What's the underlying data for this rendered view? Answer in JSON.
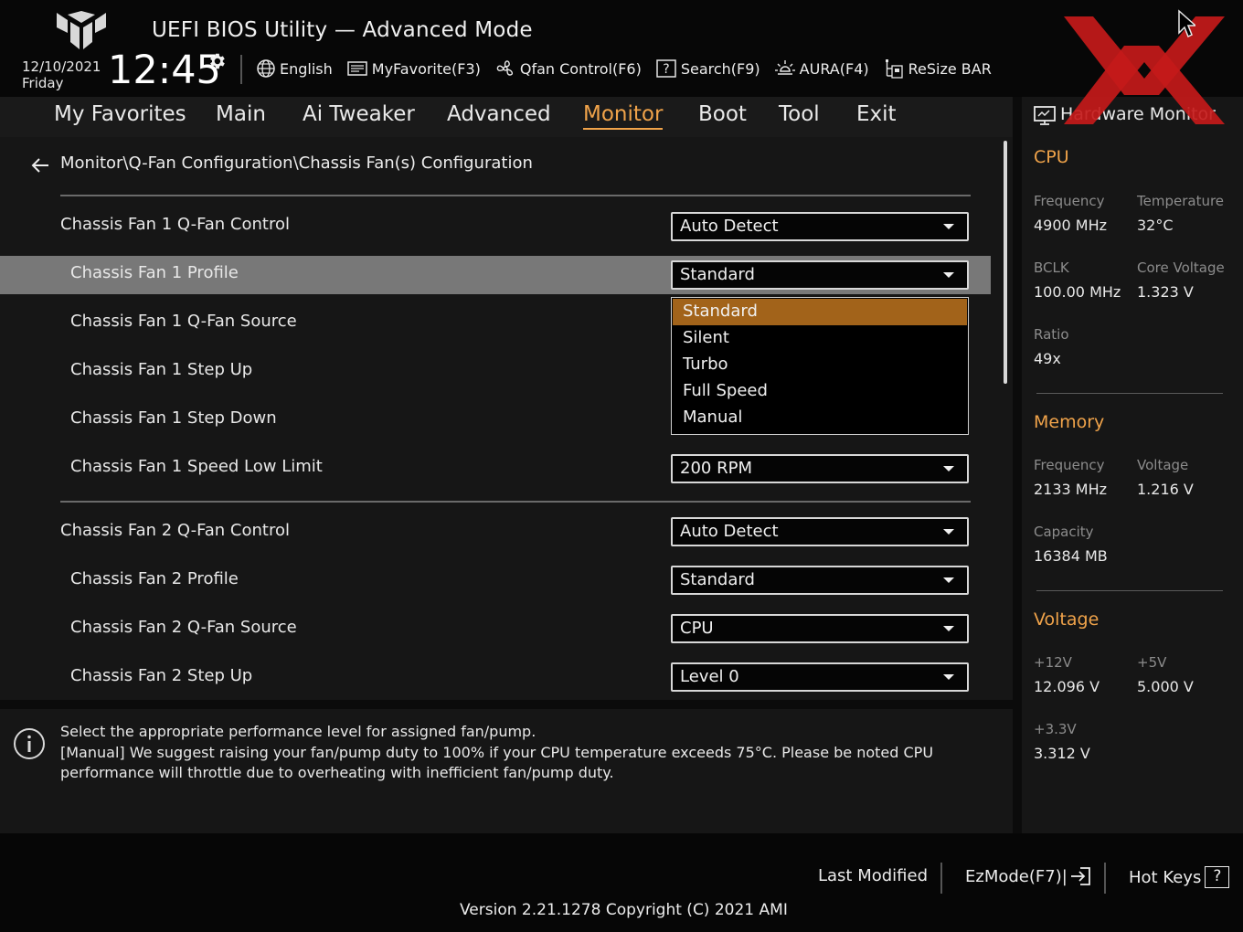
{
  "header": {
    "title": "UEFI BIOS Utility — Advanced Mode",
    "date": "12/10/2021",
    "day": "Friday",
    "time": "12:45",
    "toolbar": {
      "language": "English",
      "myfavorite": "MyFavorite(F3)",
      "qfan": "Qfan Control(F6)",
      "search": "Search(F9)",
      "aura": "AURA(F4)",
      "resize_bar": "ReSize BAR"
    }
  },
  "tabs": [
    "My Favorites",
    "Main",
    "Ai Tweaker",
    "Advanced",
    "Monitor",
    "Boot",
    "Tool",
    "Exit"
  ],
  "active_tab": "Monitor",
  "breadcrumb": "Monitor\\Q-Fan Configuration\\Chassis Fan(s) Configuration",
  "settings": [
    {
      "label": "Chassis Fan 1 Q-Fan Control",
      "value": "Auto Detect"
    },
    {
      "label": "Chassis Fan 1 Profile",
      "value": "Standard"
    },
    {
      "label": "Chassis Fan 1 Q-Fan Source",
      "value": ""
    },
    {
      "label": "Chassis Fan 1 Step Up",
      "value": ""
    },
    {
      "label": "Chassis Fan 1 Step Down",
      "value": ""
    },
    {
      "label": "Chassis Fan 1 Speed Low Limit",
      "value": "200 RPM"
    },
    {
      "label": "Chassis Fan 2 Q-Fan Control",
      "value": "Auto Detect"
    },
    {
      "label": "Chassis Fan 2 Profile",
      "value": "Standard"
    },
    {
      "label": "Chassis Fan 2 Q-Fan Source",
      "value": "CPU"
    },
    {
      "label": "Chassis Fan 2 Step Up",
      "value": "Level 0"
    }
  ],
  "profile_options": [
    "Standard",
    "Silent",
    "Turbo",
    "Full Speed",
    "Manual"
  ],
  "profile_selected": "Standard",
  "help": {
    "line1": "Select the appropriate performance level for assigned fan/pump.",
    "line2": "[Manual] We suggest raising your fan/pump duty to 100% if your CPU temperature exceeds 75°C. Please be noted CPU performance will throttle due to overheating with inefficient fan/pump duty."
  },
  "hardware_monitor": {
    "title": "Hardware Monitor",
    "cpu": {
      "heading": "CPU",
      "frequency_label": "Frequency",
      "frequency": "4900 MHz",
      "temperature_label": "Temperature",
      "temperature": "32°C",
      "bclk_label": "BCLK",
      "bclk": "100.00 MHz",
      "core_voltage_label": "Core Voltage",
      "core_voltage": "1.323 V",
      "ratio_label": "Ratio",
      "ratio": "49x"
    },
    "memory": {
      "heading": "Memory",
      "frequency_label": "Frequency",
      "frequency": "2133 MHz",
      "voltage_label": "Voltage",
      "voltage": "1.216 V",
      "capacity_label": "Capacity",
      "capacity": "16384 MB"
    },
    "voltage": {
      "heading": "Voltage",
      "v12_label": "+12V",
      "v12": "12.096 V",
      "v5_label": "+5V",
      "v5": "5.000 V",
      "v33_label": "+3.3V",
      "v33": "3.312 V"
    }
  },
  "footer": {
    "last_modified": "Last Modified",
    "ezmode": "EzMode(F7)|",
    "hotkeys": "Hot Keys",
    "hotkeys_key": "?",
    "version": "Version 2.21.1278 Copyright (C) 2021 AMI"
  },
  "colors": {
    "accent": "#f0a34a",
    "selected_option": "#a2631a",
    "watermark": "#c41a1a"
  }
}
